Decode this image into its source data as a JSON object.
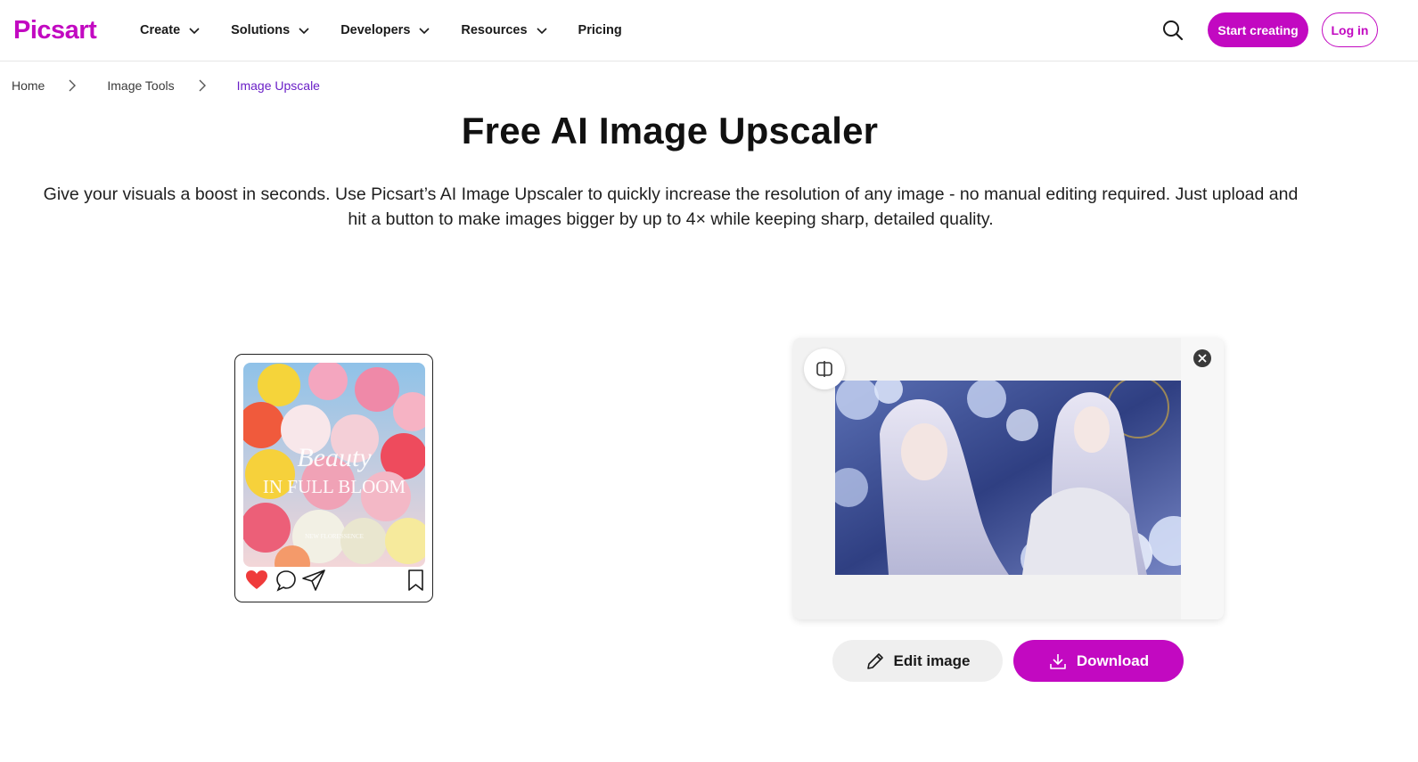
{
  "brand": {
    "name": "Picsart",
    "accent": "#c209c1",
    "link_active": "#6a1fc7"
  },
  "nav": {
    "items": [
      {
        "label": "Create",
        "has_dropdown": true
      },
      {
        "label": "Solutions",
        "has_dropdown": true
      },
      {
        "label": "Developers",
        "has_dropdown": true
      },
      {
        "label": "Resources",
        "has_dropdown": true
      },
      {
        "label": "Pricing",
        "has_dropdown": false
      }
    ],
    "search_icon": "search-icon",
    "start_label": "Start creating",
    "login_label": "Log in"
  },
  "breadcrumb": [
    {
      "label": "Home"
    },
    {
      "label": "Image Tools"
    },
    {
      "label": "Image Upscale",
      "active": true
    }
  ],
  "hero": {
    "title": "Free AI Image Upscaler",
    "subtitle_line1": "Give your visuals a boost in seconds. Use Picsart’s AI Image Upscaler to quickly increase the resolution of any image - no manual editing required. Just upload and",
    "subtitle_line2": "hit a button to make images bigger by up to 4× while keeping sharp, detailed quality."
  },
  "phone_post": {
    "caption_script": "Beauty",
    "caption_main": "IN FULL BLOOM",
    "caption_small": "NEW FLORESSENCE",
    "icons": [
      "heart-icon",
      "comment-icon",
      "share-icon",
      "bookmark-icon"
    ]
  },
  "preview": {
    "compare_icon": "compare-icon",
    "close_icon": "close-icon",
    "edit_label": "Edit image",
    "download_label": "Download"
  }
}
